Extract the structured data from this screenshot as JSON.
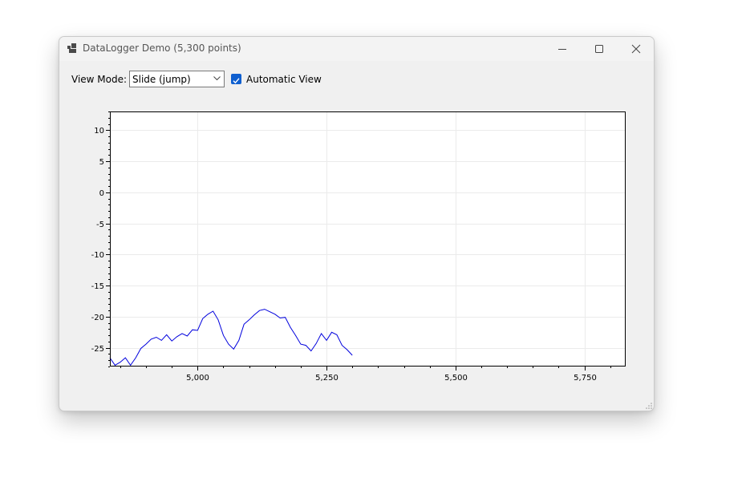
{
  "window": {
    "title": "DataLogger Demo (5,300 points)",
    "icons": {
      "app": "datalogger-app-icon",
      "minimize": "minimize-icon",
      "maximize": "maximize-icon",
      "close": "close-icon"
    }
  },
  "toolbar": {
    "view_mode_label": "View Mode:",
    "view_mode_value": "Slide (jump)",
    "automatic_view_label": "Automatic View",
    "automatic_view_checked": true
  },
  "chart_data": {
    "type": "line",
    "title": "",
    "xlabel": "",
    "ylabel": "",
    "xlim": [
      4830,
      5830
    ],
    "ylim": [
      -28,
      13
    ],
    "x_ticks": [
      5000,
      5250,
      5500,
      5750
    ],
    "x_tick_labels": [
      "5,000",
      "5,250",
      "5,500",
      "5,750"
    ],
    "y_ticks": [
      10,
      5,
      0,
      -5,
      -10,
      -15,
      -20,
      -25
    ],
    "y_tick_labels": [
      "10",
      "5",
      "0",
      "-5",
      "-10",
      "-15",
      "-20",
      "-25"
    ],
    "grid": true,
    "series": [
      {
        "color": "#0000dd",
        "x": [
          4830,
          4840,
          4850,
          4860,
          4870,
          4880,
          4890,
          4900,
          4910,
          4920,
          4930,
          4940,
          4950,
          4960,
          4970,
          4980,
          4990,
          5000,
          5010,
          5020,
          5030,
          5040,
          5050,
          5060,
          5070,
          5080,
          5090,
          5100,
          5110,
          5120,
          5130,
          5140,
          5150,
          5160,
          5170,
          5180,
          5190,
          5200,
          5210,
          5220,
          5230,
          5240,
          5250,
          5260,
          5270,
          5280,
          5290,
          5300
        ],
        "y": [
          -26.6,
          -27.8,
          -27.3,
          -26.6,
          -27.8,
          -26.6,
          -25.1,
          -24.4,
          -23.6,
          -23.3,
          -23.8,
          -22.9,
          -23.9,
          -23.2,
          -22.7,
          -23.1,
          -22.1,
          -22.2,
          -20.3,
          -19.6,
          -19.1,
          -20.5,
          -23.0,
          -24.4,
          -25.2,
          -23.8,
          -21.2,
          -20.5,
          -19.7,
          -19.0,
          -18.8,
          -19.2,
          -19.6,
          -20.2,
          -20.1,
          -21.7,
          -23.0,
          -24.4,
          -24.6,
          -25.5,
          -24.3,
          -22.7,
          -23.8,
          -22.5,
          -22.9,
          -24.6,
          -25.3,
          -26.2
        ]
      }
    ]
  }
}
